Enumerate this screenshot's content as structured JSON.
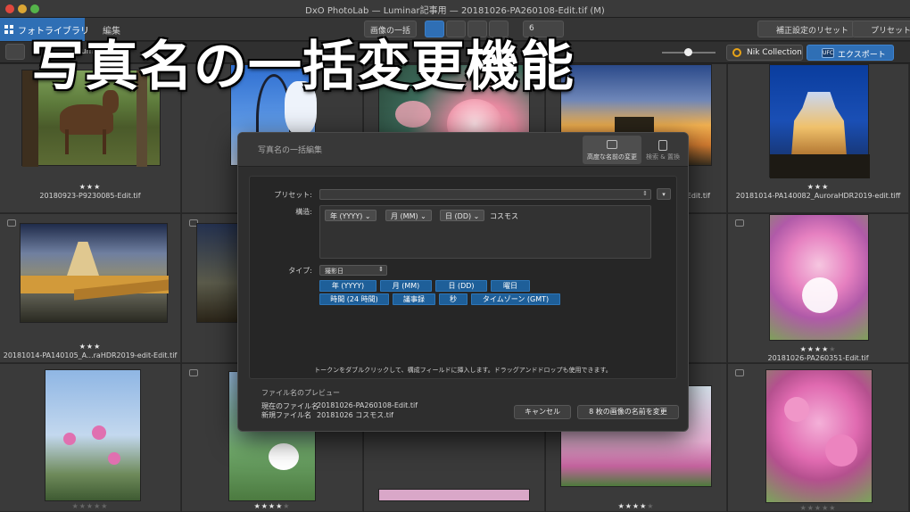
{
  "window": {
    "title": "DxO PhotoLab — Luminar記事用 — 20181026-PA260108-Edit.tif (M)"
  },
  "toolbar": {
    "tab_library": "フォトライブラリ",
    "tab_customize": "編集",
    "sort_label": "画像の一括",
    "count_label": "6",
    "reset_button": "補正設定のリセット",
    "preset_button": "プリセット",
    "filter_label": "Luminar"
  },
  "toolbar2": {
    "nik_button": "Nik Collection",
    "export_button": "エクスポート",
    "export_badge": "UFC"
  },
  "caption": "写真名の一括変更機能",
  "grid": {
    "cells": [
      {
        "name": "20180923-P9230085-Edit.tif",
        "stars": "★★★",
        "empty": ""
      },
      {
        "name": "",
        "stars": "",
        "empty": ""
      },
      {
        "name": "",
        "stars": "",
        "empty": ""
      },
      {
        "name": "",
        "stars": "",
        "empty": ""
      },
      {
        "name": "20181014-PA140082_AuroraHDR2019-edit.tiff",
        "stars": "★★★",
        "empty": ""
      },
      {
        "name": "20181014-PA140105_A...raHDR2019-edit-Edit.tif",
        "stars": "★★★",
        "empty": ""
      },
      {
        "name": "",
        "stars": "",
        "empty": ""
      },
      {
        "name": "",
        "stars": "",
        "empty": ""
      },
      {
        "name": "",
        "stars": "",
        "empty": ""
      },
      {
        "name": "20181026-PA260351-Edit.tif",
        "stars": "★★★★",
        "empty": "★"
      },
      {
        "name": "",
        "stars": "",
        "empty": "★★★★★"
      },
      {
        "name": "",
        "stars": "★★★★",
        "empty": "★"
      },
      {
        "name": "",
        "stars": "",
        "empty": ""
      },
      {
        "name": "",
        "stars": "★★★★",
        "empty": "★"
      },
      {
        "name": "",
        "stars": "",
        "empty": "★★★★★"
      }
    ],
    "partial_name_r1c4": "-Edit.tif"
  },
  "dialog": {
    "title": "写真名の一括編集",
    "mode_advanced": "高度な名前の変更",
    "mode_search": "検索 & 置換",
    "preset_label": "プリセット:",
    "structure_label": "構造:",
    "structure_tokens": [
      "年 (YYYY)",
      "月 (MM)",
      "日 (DD)"
    ],
    "structure_text": "コスモス",
    "type_label": "タイプ:",
    "type_value": "撮影日",
    "tokens_row1": [
      "年 (YYYY)",
      "月 (MM)",
      "日 (DD)",
      "曜日"
    ],
    "tokens_row2": [
      "時間 (24 時間)",
      "議事録",
      "秒",
      "タイムゾーン (GMT)"
    ],
    "hint": "トークンをダブルクリックして、構成フィールドに挿入します。ドラッグアンドドロップも使用できます。",
    "preview_title": "ファイル名のプレビュー",
    "current_label": "現在のファイル名",
    "current_value": "20181026-PA260108-Edit.tif",
    "new_label": "新規ファイル名",
    "new_value": "20181026 コスモス.tif",
    "cancel_button": "キャンセル",
    "rename_button": "8 枚の画像の名前を変更"
  }
}
